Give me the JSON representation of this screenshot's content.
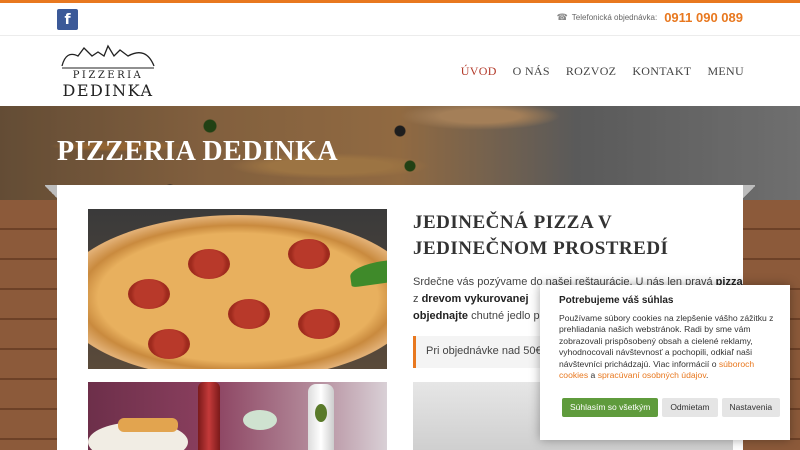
{
  "topbar": {
    "facebook_icon": "facebook-icon",
    "phone_icon": "phone-icon",
    "phone_label": "Telefonická objednávka:",
    "phone_number": "0911 090 089"
  },
  "logo": {
    "line1": "PIZZERIA",
    "line2": "DEDINKA"
  },
  "nav": {
    "items": [
      {
        "label": "ÚVOD"
      },
      {
        "label": "O NÁS"
      },
      {
        "label": "ROZVOZ"
      },
      {
        "label": "KONTAKT"
      },
      {
        "label": "MENU"
      }
    ]
  },
  "hero": {
    "title": "PIZZERIA DEDINKA"
  },
  "main": {
    "heading_part1": "JEDINEČNÁ ",
    "heading_strong": "PIZZA",
    "heading_part2": " V JEDINEČNOM PROSTREDÍ",
    "intro_part1": "Srdečne vás pozývame do našej reštaurácie. U nás len pravá ",
    "intro_strong1": "pizza",
    "intro_part2": " z ",
    "intro_strong2": "drevom vykurovanej",
    "intro_part3": " ",
    "intro_strong3": "objednajte",
    "intro_part4": " chutné jedlo pri",
    "order_note": "Pri objednávke nad 50€ -"
  },
  "cookie": {
    "title": "Potrebujeme váš súhlas",
    "text": "Používame súbory cookies na zlepšenie vášho zážitku z prehliadania našich webstránok. Radi by sme vám zobrazovali prispôsobený obsah a cielené reklamy, vyhodnocovali návštevnosť a pochopili, odkiaľ naši návštevníci prichádzajú. Viac informácií o ",
    "link1": "súboroch cookies",
    "between": " a ",
    "link2": "spracúvaní osobných údajov",
    "end": ".",
    "accept_label": "Súhlasím so všetkým",
    "reject_label": "Odmietam",
    "settings_label": "Nastavenia",
    "accent_color": "#e8781f",
    "accept_color": "#5f9b3c"
  }
}
